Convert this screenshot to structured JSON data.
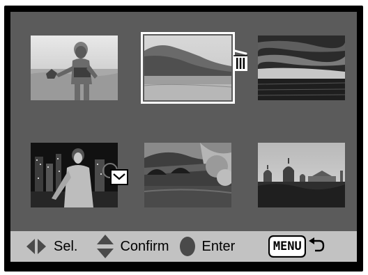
{
  "screen": {
    "thumbnails": [
      {
        "subject": "girl at the beach holding a starfish",
        "selected": false,
        "mark": null
      },
      {
        "subject": "rocky coastline and beach",
        "selected": true,
        "mark": "trash-icon"
      },
      {
        "subject": "sunset clouds over the sea",
        "selected": false,
        "mark": null
      },
      {
        "subject": "woman in front of a city skyline at night",
        "selected": false,
        "mark": "envelope-icon"
      },
      {
        "subject": "stone bridge over a river with trees",
        "selected": false,
        "mark": null
      },
      {
        "subject": "cathedral domes and city skyline",
        "selected": false,
        "mark": null
      }
    ]
  },
  "statusbar": {
    "select_label": "Sel.",
    "confirm_label": "Confirm",
    "enter_label": "Enter",
    "menu_label": "MENU",
    "select_icon": "left-right-arrows-icon",
    "confirm_icon": "up-down-arrows-icon",
    "enter_icon": "center-button-icon",
    "back_icon": "return-arrow-icon"
  },
  "colors": {
    "background": "#5b5b5b",
    "statusbar": "#c2c2c2",
    "frame": "#000000",
    "selection": "#ffffff"
  }
}
